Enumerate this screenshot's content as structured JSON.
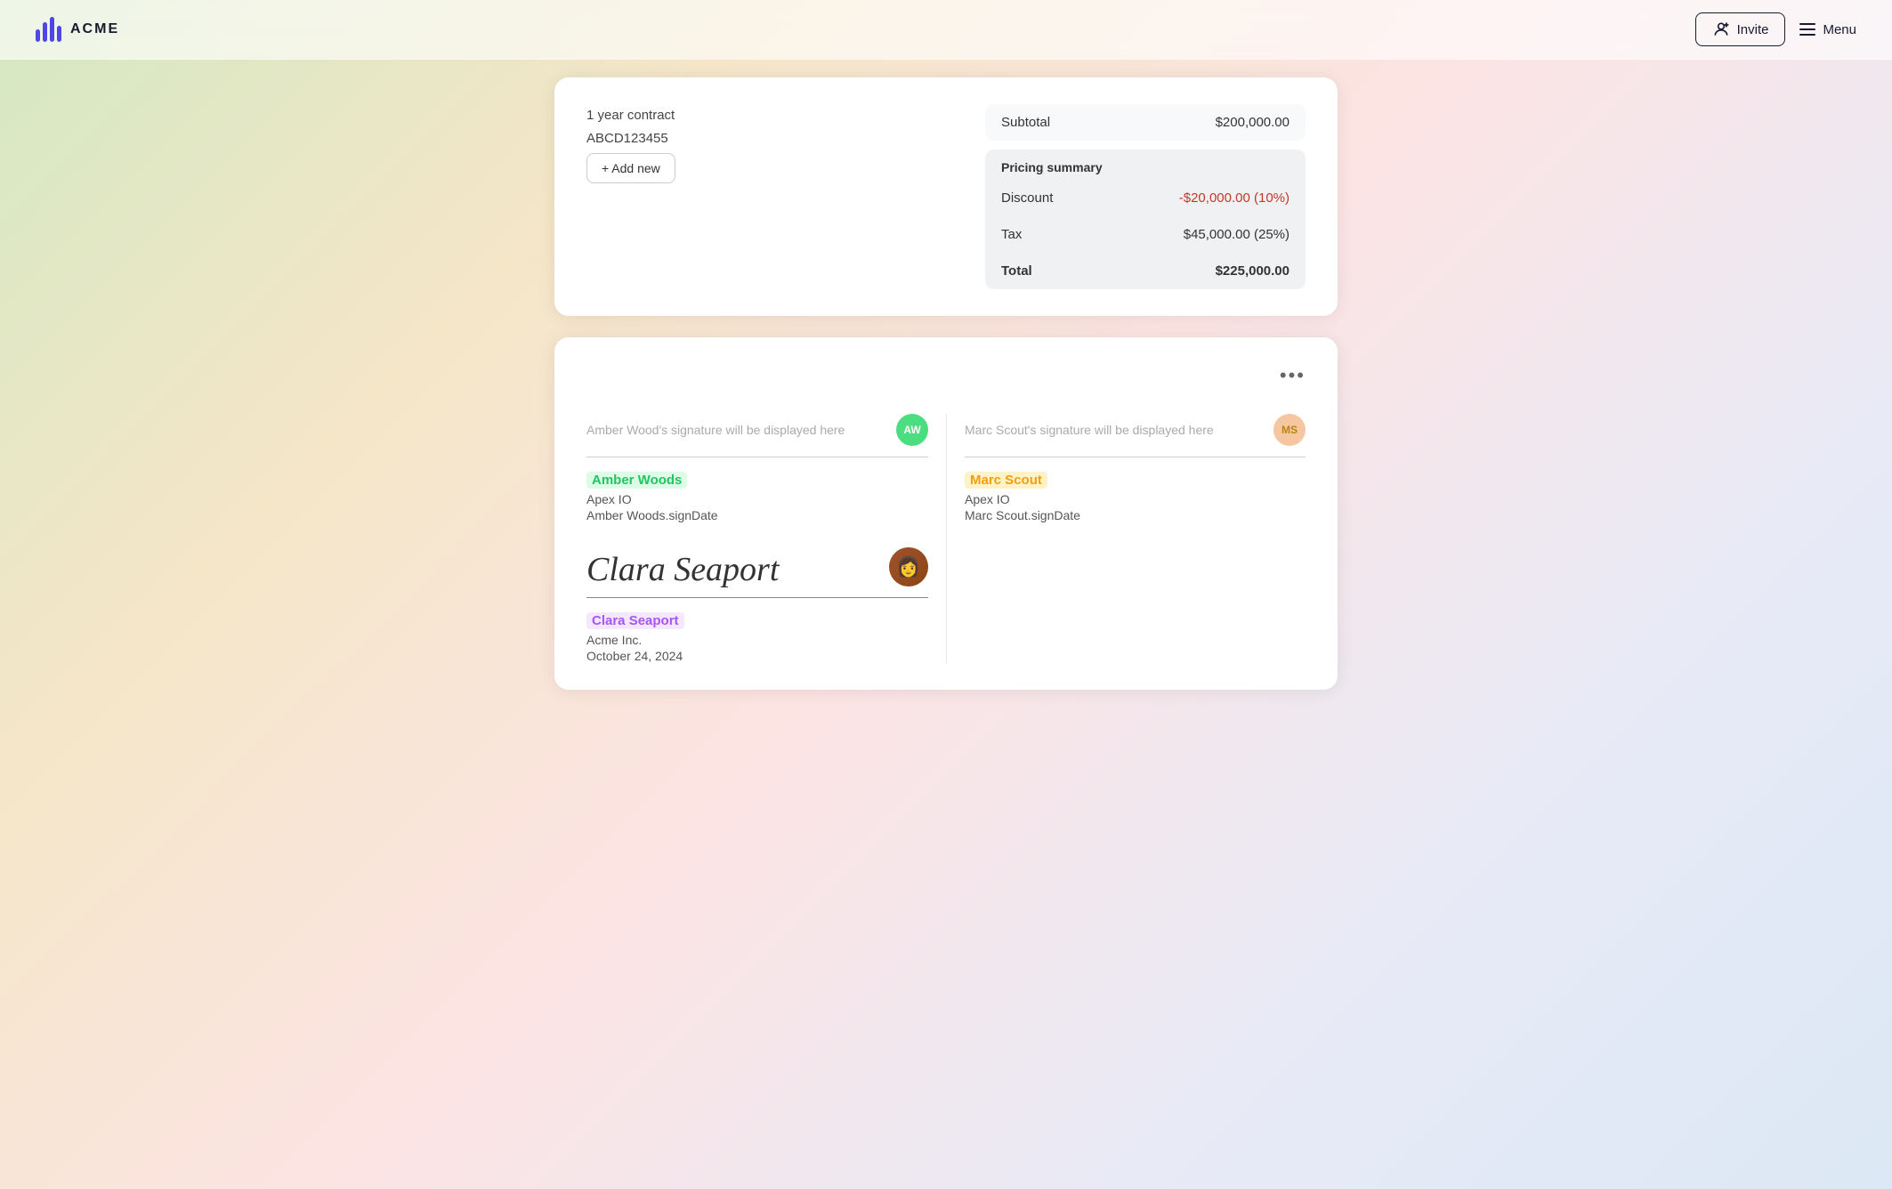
{
  "app": {
    "name": "ACME"
  },
  "header": {
    "invite_label": "Invite",
    "menu_label": "Menu"
  },
  "top_card": {
    "contract_line1": "1 year contract",
    "contract_line2": "ABCD123455",
    "add_new_label": "+ Add new",
    "pricing": {
      "subtotal_label": "Subtotal",
      "subtotal_value": "$200,000.00",
      "summary_title": "Pricing summary",
      "discount_label": "Discount",
      "discount_value": "-$20,000.00 (10%)",
      "tax_label": "Tax",
      "tax_value": "$45,000.00 (25%)",
      "total_label": "Total",
      "total_value": "$225,000.00"
    }
  },
  "signature_card": {
    "dots": "•••",
    "signers": [
      {
        "id": "amber",
        "placeholder": "Amber Wood's signature will be displayed here",
        "avatar_initials": "AW",
        "name": "Amber Woods",
        "company": "Apex IO",
        "sign_date": "Amber Woods.signDate"
      },
      {
        "id": "marc",
        "placeholder": "Marc Scout's signature will be displayed here",
        "avatar_initials": "MS",
        "name": "Marc Scout",
        "company": "Apex IO",
        "sign_date": "Marc Scout.signDate"
      }
    ],
    "signed_signer": {
      "name": "Clara Seaport",
      "company": "Acme Inc.",
      "date": "October 24, 2024",
      "script_sig": "Clara Seaport"
    }
  }
}
